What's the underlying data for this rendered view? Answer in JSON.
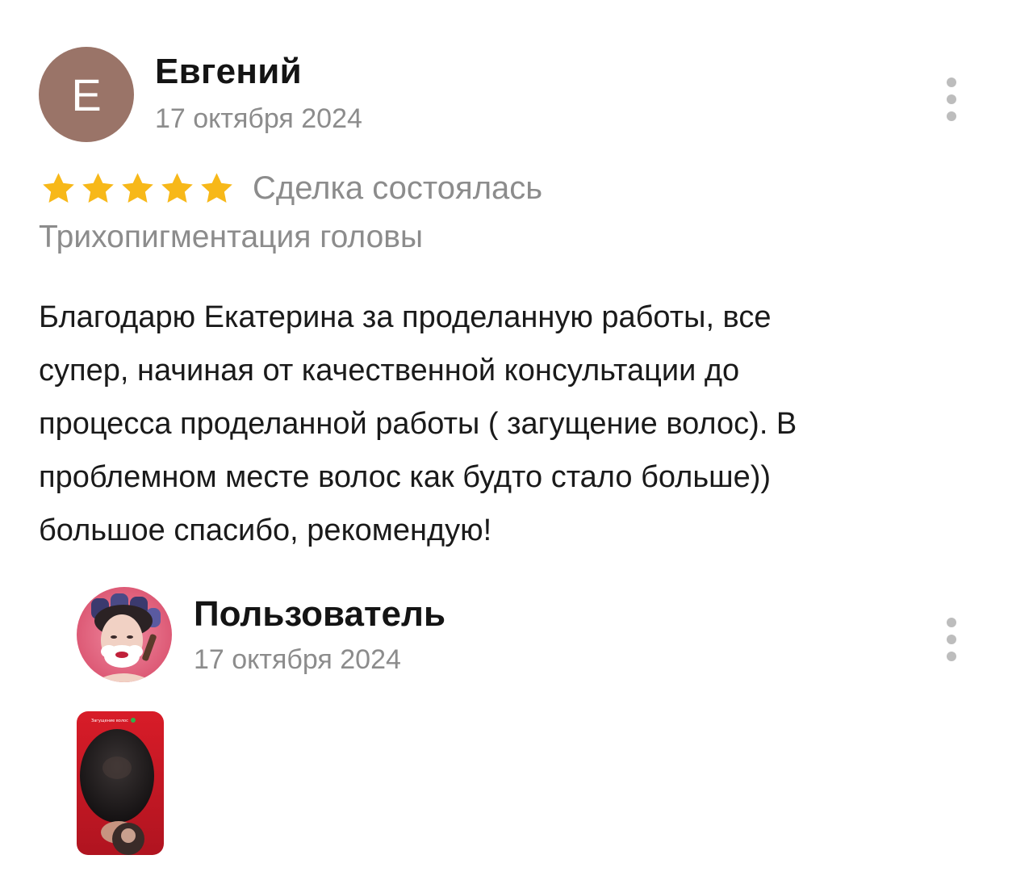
{
  "review": {
    "author": {
      "initial": "Е",
      "name": "Евгений",
      "date": "17 октября 2024",
      "avatar_color": "#9a7468"
    },
    "rating": 5,
    "star_color": "#f7b819",
    "deal_status": "Сделка состоялась",
    "service": "Трихопигментация головы",
    "text": "Благодарю Екатерина за проделанную работы, все\nсупер, начиная от качественной консультации до\nпроцесса проделанной работы ( загущение волос). В\nпроблемном месте волос как будто стало больше))\nбольшое спасибо, рекомендую!"
  },
  "reply": {
    "author": {
      "name": "Пользователь",
      "date": "17 октября 2024"
    },
    "attachment": {
      "caption": "Загущение волос"
    }
  },
  "icons": {
    "more": "more-vertical-icon",
    "star": "star-icon"
  }
}
